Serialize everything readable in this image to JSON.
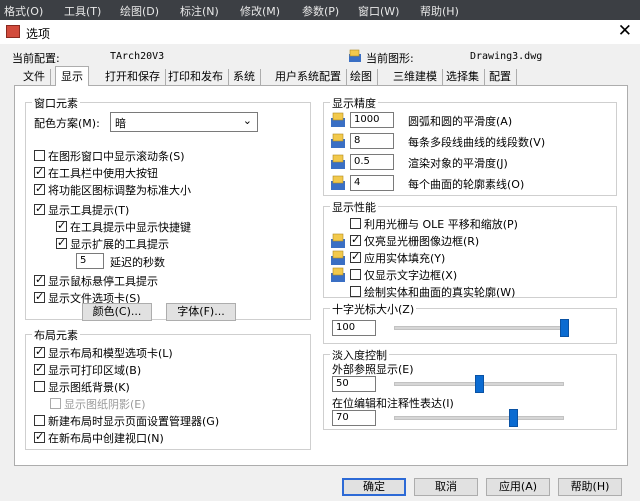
{
  "menubar": [
    "格式(O)",
    "工具(T)",
    "绘图(D)",
    "标注(N)",
    "修改(M)",
    "参数(P)",
    "窗口(W)",
    "帮助(H)"
  ],
  "window": {
    "title": "选项"
  },
  "config": {
    "current_profile_label": "当前配置:",
    "current_profile_value": "TArch20V3",
    "current_drawing_label": "当前图形:",
    "current_drawing_value": "Drawing3.dwg"
  },
  "tabs": [
    "文件",
    "显示",
    "打开和保存",
    "打印和发布",
    "系统",
    "用户系统配置",
    "绘图",
    "三维建模",
    "选择集",
    "配置"
  ],
  "active_tab": "显示",
  "window_elements": {
    "title": "窗口元素",
    "color_scheme_label": "配色方案(M):",
    "color_scheme_value": "暗",
    "checks": [
      {
        "label": "在图形窗口中显示滚动条(S)",
        "checked": false
      },
      {
        "label": "在工具栏中使用大按钮",
        "checked": true
      },
      {
        "label": "将功能区图标调整为标准大小",
        "checked": true
      },
      {
        "label": "显示工具提示(T)",
        "checked": true
      },
      {
        "label": "在工具提示中显示快捷键",
        "checked": true
      },
      {
        "label": "显示扩展的工具提示",
        "checked": true
      },
      {
        "label": "显示鼠标悬停工具提示",
        "checked": true
      },
      {
        "label": "显示文件选项卡(S)",
        "checked": true
      }
    ],
    "delay_value": "5",
    "delay_label": "延迟的秒数",
    "colors_button": "颜色(C)...",
    "fonts_button": "字体(F)..."
  },
  "layout_elements": {
    "title": "布局元素",
    "checks": [
      {
        "label": "显示布局和模型选项卡(L)",
        "checked": true
      },
      {
        "label": "显示可打印区域(B)",
        "checked": true
      },
      {
        "label": "显示图纸背景(K)",
        "checked": false
      },
      {
        "label": "显示图纸阴影(E)",
        "checked": false,
        "disabled": true
      },
      {
        "label": "新建布局时显示页面设置管理器(G)",
        "checked": false
      },
      {
        "label": "在新布局中创建视口(N)",
        "checked": true
      }
    ]
  },
  "display_resolution": {
    "title": "显示精度",
    "rows": [
      {
        "value": "1000",
        "label": "圆弧和圆的平滑度(A)"
      },
      {
        "value": "8",
        "label": "每条多段线曲线的线段数(V)"
      },
      {
        "value": "0.5",
        "label": "渲染对象的平滑度(J)"
      },
      {
        "value": "4",
        "label": "每个曲面的轮廓素线(O)"
      }
    ]
  },
  "display_performance": {
    "title": "显示性能",
    "checks": [
      {
        "label": "利用光栅与 OLE 平移和缩放(P)",
        "checked": false
      },
      {
        "label": "仅亮显光栅图像边框(R)",
        "checked": true
      },
      {
        "label": "应用实体填充(Y)",
        "checked": true
      },
      {
        "label": "仅显示文字边框(X)",
        "checked": false
      },
      {
        "label": "绘制实体和曲面的真实轮廓(W)",
        "checked": false
      }
    ]
  },
  "crosshair": {
    "title": "十字光标大小(Z)",
    "value": "100",
    "level_percent": 100
  },
  "fade": {
    "title": "淡入度控制",
    "xref_label": "外部参照显示(E)",
    "xref_value": "50",
    "xref_level_percent": 50,
    "inplace_label": "在位编辑和注释性表达(I)",
    "inplace_value": "70",
    "inplace_level_percent": 70
  },
  "footer": {
    "ok": "确定",
    "cancel": "取消",
    "apply": "应用(A)",
    "help": "帮助(H)"
  },
  "colors": {
    "menubar_bg": "#3c3f44",
    "accent": "#0b6bd1",
    "focus_border": "#2d6ad6"
  }
}
